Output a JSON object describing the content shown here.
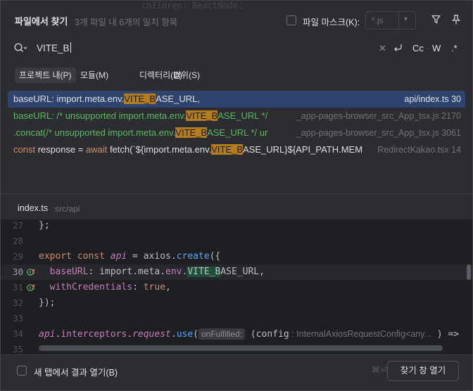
{
  "header": {
    "title": "파일에서 찾기",
    "match_count": "3개 파일 내 6개의 일치 항목",
    "background_code": "children: ReactNode;",
    "file_mask_label": "파일 마스크(K):",
    "file_mask_value": "*.js",
    "file_mask_checked": false
  },
  "search": {
    "query": "VITE_B",
    "options": [
      "Cc",
      "W",
      ".*"
    ]
  },
  "scopes": [
    {
      "label": "프로젝트 내(P)",
      "selected": true
    },
    {
      "label": "모듈(M)",
      "selected": false
    },
    {
      "label": "디렉터리(D)",
      "selected": false
    },
    {
      "label": "범위(S)",
      "selected": false
    }
  ],
  "results": [
    {
      "pre": "baseURL: import.meta.env.",
      "match": "VITE_B",
      "post": "ASE_URL,",
      "file": "api/index.ts 30"
    },
    {
      "pre": "baseURL: /* unsupported import.meta.env.",
      "match": "VITE_B",
      "post": "ASE_URL */",
      "file": "_app-pages-browser_src_App_tsx.js 2170"
    },
    {
      "pre": ".concat(/* unsupported import.meta.env.",
      "match": "VITE_B",
      "post": "ASE_URL */ ur",
      "file": "_app-pages-browser_src_App_tsx.js 3061"
    },
    {
      "pre_kw1": "const",
      "pre1": " response = ",
      "pre_kw2": "await",
      "pre2": " fetch(`${import.meta.env.",
      "match": "VITE_B",
      "post": "ASE_URL}${API_PATH.MEM",
      "file": "RedirectKakao.tsx 14"
    }
  ],
  "preview": {
    "file_name": "index.ts",
    "file_path": "src/api",
    "lines": [
      {
        "no": "27",
        "code": "};"
      },
      {
        "no": "28",
        "code": ""
      },
      {
        "no": "29",
        "kw": "export const ",
        "var": "api",
        "eq": " = axios.",
        "fn": "create",
        "rest": "({"
      },
      {
        "no": "30",
        "prop": "baseURL",
        "pre": ": import.meta.",
        "prop2": "env",
        "dot": ".",
        "match": "VITE_B",
        "post": "ASE_URL,"
      },
      {
        "no": "31",
        "prop": "withCredentials",
        "pre": ": ",
        "kw": "true",
        "post": ","
      },
      {
        "no": "32",
        "code": "});"
      },
      {
        "no": "33",
        "code": ""
      },
      {
        "no": "34",
        "var": "api",
        "dot1": ".",
        "prop": "interceptors",
        "dot2": ".",
        "var2": "request",
        "dot3": ".",
        "fn": "use",
        "paren": "(",
        "hint": "onFulfilled:",
        "rest": " (config",
        "type": " : InternalAxiosRequestConfig<any...",
        "close": " ) =>"
      },
      {
        "no": "35",
        "code": ""
      }
    ]
  },
  "footer": {
    "new_tab_label": "새 탭에서 결과 열기(B)",
    "new_tab_checked": false,
    "shortcut": "⌘⏎",
    "open_button": "찾기 창 열기"
  },
  "colors": {
    "background": "#2b2d30",
    "editor_bg": "#1e1f22",
    "selection": "#2e436e",
    "match_highlight": "#b37c1e",
    "green_text": "#5fb865",
    "keyword": "#cf8e6d",
    "function": "#56a8f5",
    "property": "#c77dbb"
  }
}
